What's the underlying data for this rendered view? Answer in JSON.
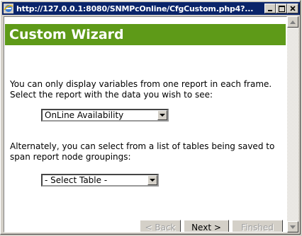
{
  "window": {
    "title": "http://127.0.0.1:8080/SNMPcOnline/CfgCustom.php4?...",
    "controls": [
      "minimize",
      "maximize",
      "close"
    ]
  },
  "page": {
    "banner_title": "Custom Wizard",
    "banner_color": "#5e9a18",
    "para1": "You can only display variables from one report in each frame. Select the report with the data you wish to see:",
    "report_select": {
      "selected": "OnLine Availability"
    },
    "para2": "Alternately, you can select from a list of tables being saved to span report node groupings:",
    "table_select": {
      "selected": "- Select Table -"
    }
  },
  "buttons": {
    "back": "< Back",
    "next": "Next >",
    "finished": "Finshed"
  }
}
